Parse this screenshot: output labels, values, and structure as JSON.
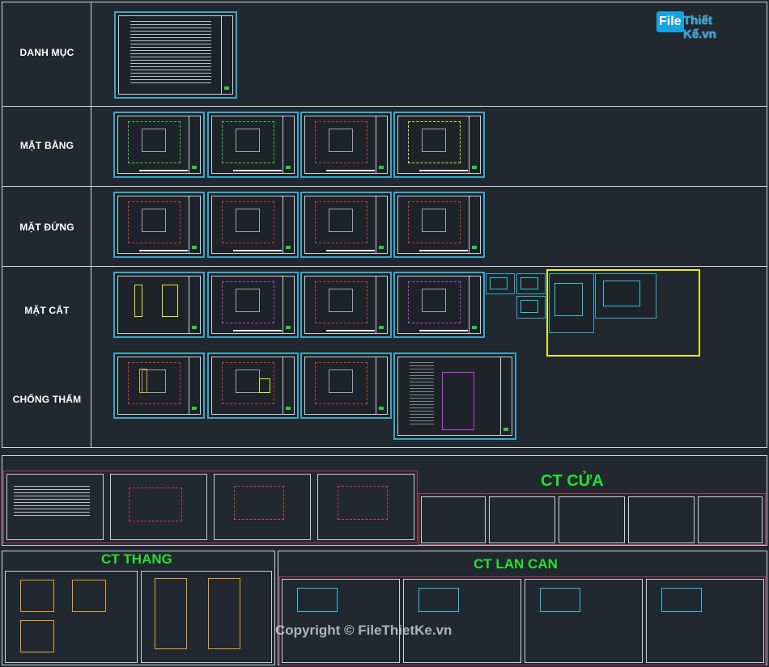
{
  "watermark": {
    "logo_left": "File",
    "logo_right": "Thiết Kế.vn",
    "copyright": "Copyright © FileThietKe.vn"
  },
  "rows": {
    "danh_muc": "DANH MỤC",
    "mat_bang": "MẶT BẰNG",
    "mat_dung": "MẶT ĐỨNG",
    "mat_cat": "MẶT CẮT",
    "chong_tham": "CHỐNG THẤM"
  },
  "section_titles": {
    "ct_cua": "CT CỬA",
    "ct_thang": "CT THANG",
    "ct_lan_can": "CT LAN CAN"
  },
  "colors": {
    "sheet_border": "#3aa8c8",
    "group_border": "#b23a4e",
    "highlight": "#e8e82a",
    "title_green": "#26e02e",
    "background": "#212830"
  }
}
